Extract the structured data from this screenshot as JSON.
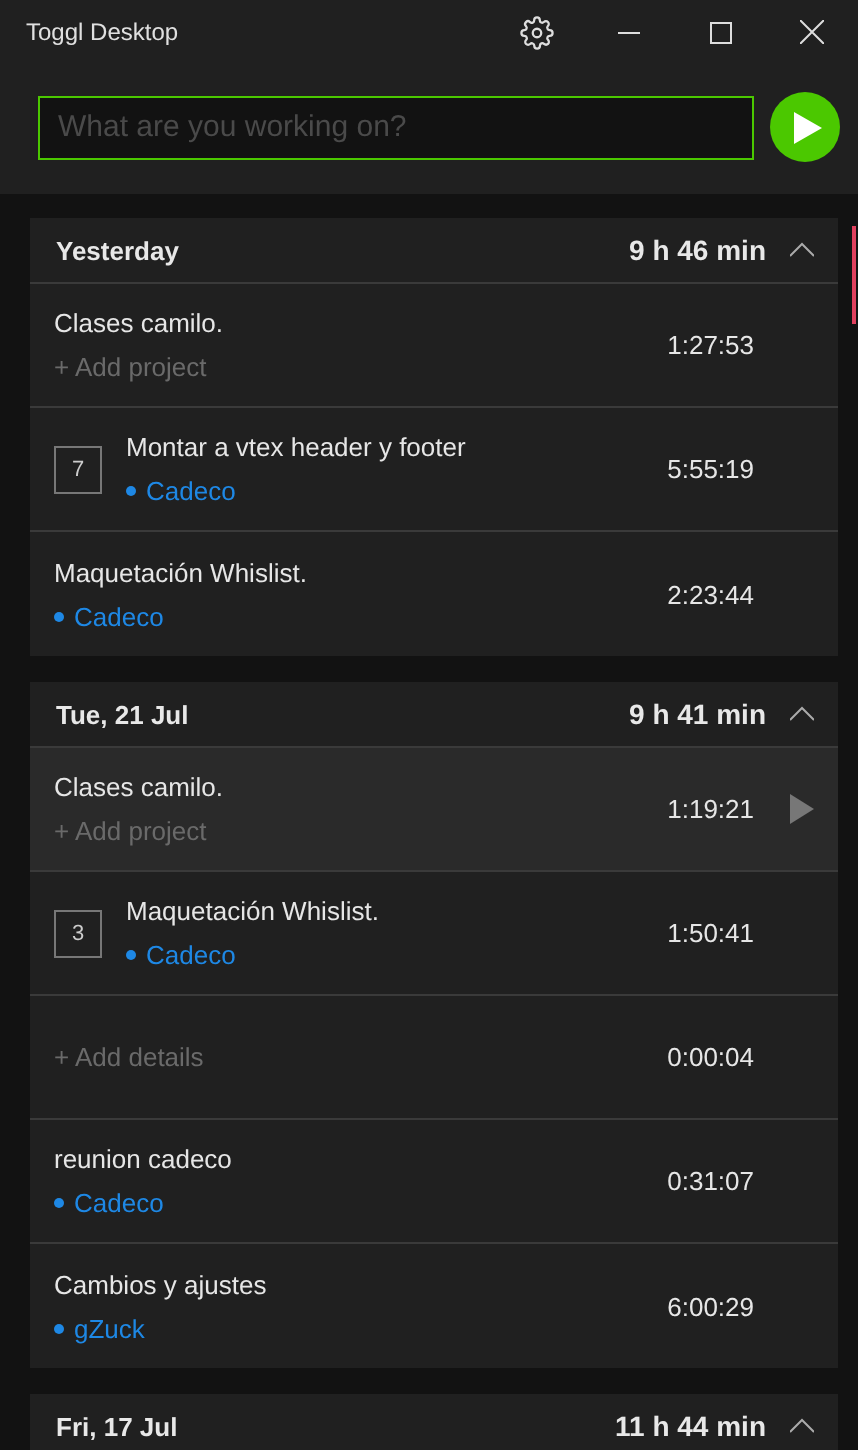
{
  "window": {
    "title": "Toggl Desktop"
  },
  "timer": {
    "placeholder": "What are you working on?"
  },
  "groups": [
    {
      "date": "Yesterday",
      "total": "9 h 46 min",
      "expanded": true,
      "entries": [
        {
          "description": "Clases camilo.",
          "add_label": "+ Add project",
          "duration": "1:27:53",
          "hovered": false
        },
        {
          "count": "7",
          "description": "Montar a vtex header y footer",
          "project": {
            "name": "Cadeco",
            "color": "#1e88e5"
          },
          "duration": "5:55:19",
          "hovered": false
        },
        {
          "description": "Maquetación Whislist.",
          "project": {
            "name": "Cadeco",
            "color": "#1e88e5"
          },
          "duration": "2:23:44",
          "hovered": false
        }
      ]
    },
    {
      "date": "Tue, 21 Jul",
      "total": "9 h 41 min",
      "expanded": true,
      "entries": [
        {
          "description": "Clases camilo.",
          "add_label": "+ Add project",
          "duration": "1:19:21",
          "hovered": true
        },
        {
          "count": "3",
          "description": "Maquetación Whislist.",
          "project": {
            "name": "Cadeco",
            "color": "#1e88e5"
          },
          "duration": "1:50:41",
          "hovered": false
        },
        {
          "add_label": "+ Add details",
          "duration": "0:00:04",
          "hovered": false
        },
        {
          "description": "reunion cadeco",
          "project": {
            "name": "Cadeco",
            "color": "#1e88e5"
          },
          "duration": "0:31:07",
          "hovered": false
        },
        {
          "description": "Cambios y ajustes",
          "project": {
            "name": "gZuck",
            "color": "#1e88e5"
          },
          "duration": "6:00:29",
          "hovered": false
        }
      ]
    },
    {
      "date": "Fri, 17 Jul",
      "total": "11 h 44 min",
      "expanded": true
    }
  ]
}
